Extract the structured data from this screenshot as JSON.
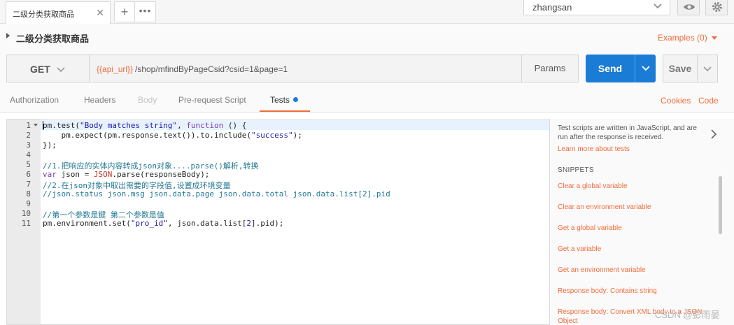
{
  "tabs": {
    "active_tab_label": "二级分类获取商品",
    "add_label": "+",
    "more_label": "•••"
  },
  "environment": {
    "selected": "zhangsan"
  },
  "request": {
    "name": "二级分类获取商品",
    "examples_label": "Examples (0)",
    "method": "GET",
    "url_variable": "{{api_url}}",
    "url_path": "/shop/mfindByPageCsid?csid=1&page=1",
    "params_label": "Params",
    "send_label": "Send",
    "save_label": "Save"
  },
  "subtabs": {
    "authorization": "Authorization",
    "headers": "Headers",
    "body": "Body",
    "prerequest": "Pre-request Script",
    "tests": "Tests",
    "cookies": "Cookies",
    "code": "Code"
  },
  "editor": {
    "line_numbers": [
      "1",
      "2",
      "3",
      "4",
      "5",
      "6",
      "7",
      "8",
      "9",
      "10",
      "11"
    ],
    "lines": {
      "l1_a": "pm.test(",
      "l1_str": "\"Body matches string\"",
      "l1_b": ", ",
      "l1_kw": "function",
      "l1_c": " () {",
      "l2_a": "    pm.expect(pm.response.text()).to.include(",
      "l2_str": "\"success\"",
      "l2_b": ");",
      "l3": "});",
      "l5": "//1.把响应的实体内容转成json对象....parse()解析,转换",
      "l6_kw": "var",
      "l6_a": " json = ",
      "l6_id": "JSON",
      "l6_b": ".parse(responseBody);",
      "l7": "//2.在json对象中取出需要的字段值,设置成环境变量",
      "l8": "//json.status json.msg json.data.page json.data.total json.data.list[2].pid",
      "l10": "//第一个参数是键 第二个参数是值",
      "l11_a": "pm.environment.set(",
      "l11_str": "\"pro_id\"",
      "l11_b": ", json.data.list[",
      "l11_num": "2",
      "l11_c": "].pid);"
    }
  },
  "snippets": {
    "description": "Test scripts are written in JavaScript, and are run after the response is received.",
    "learn_more": "Learn more about tests",
    "heading": "SNIPPETS",
    "items": [
      "Clear a global variable",
      "Clear an environment variable",
      "Get a global variable",
      "Get a variable",
      "Get an environment variable",
      "Response body: Contains string",
      "Response body: Convert XML body to a JSON Object"
    ]
  },
  "watermark": "CSDN @彭雨晏",
  "colors": {
    "accent": "#f26b3a",
    "primary": "#1b7cd6"
  }
}
